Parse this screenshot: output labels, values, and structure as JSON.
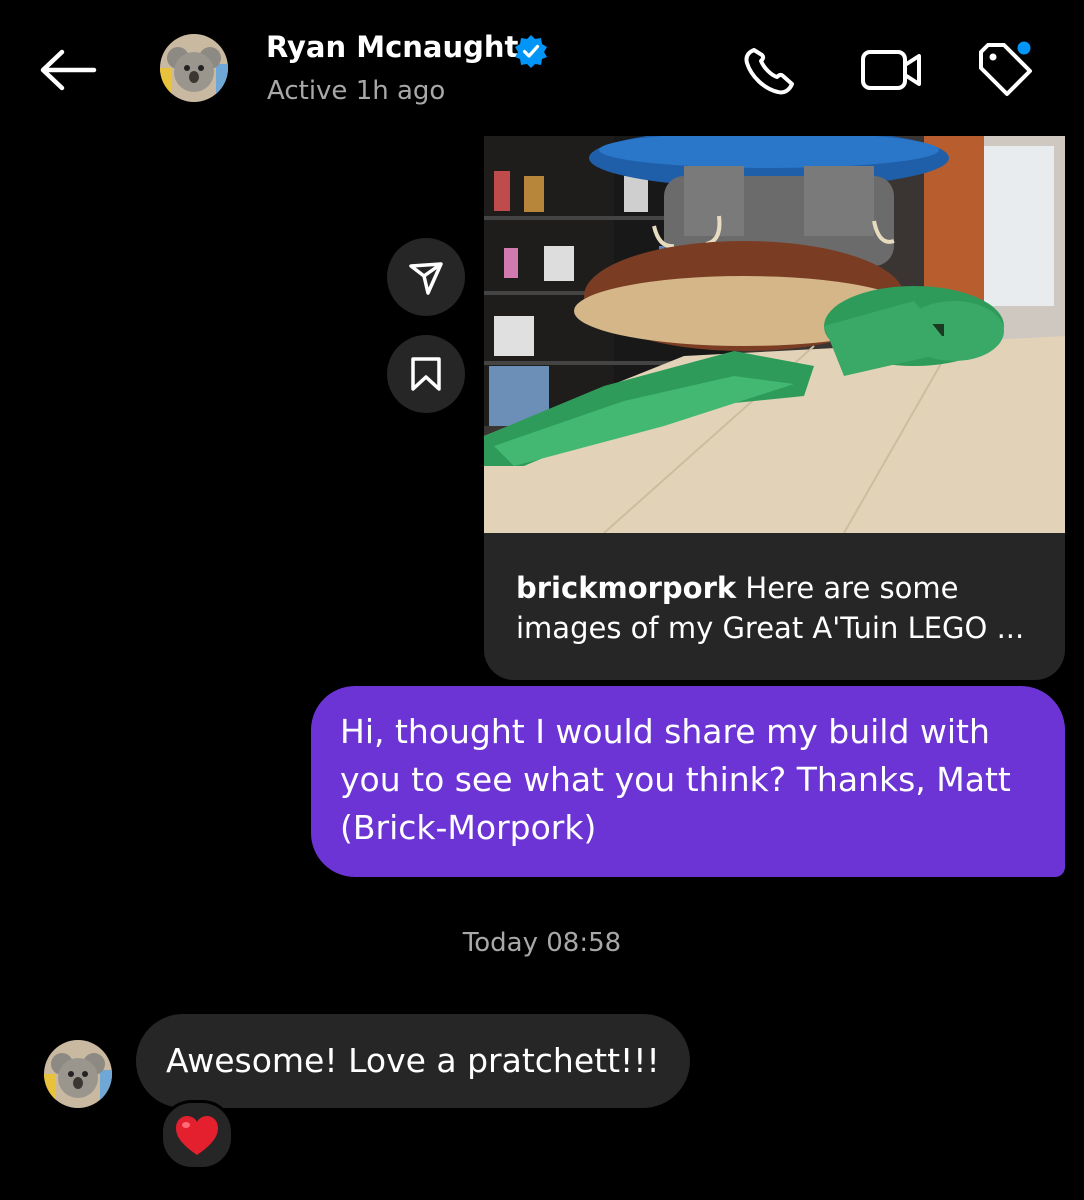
{
  "header": {
    "contact_name": "Ryan Mcnaught",
    "status": "Active 1h ago",
    "verified": true
  },
  "shared_post": {
    "username": "brickmorpork",
    "caption": "Here are some images of my Great A'Tuin LEGO ..."
  },
  "messages": {
    "sent_text": "Hi, thought I would share my build with you to see what you think? Thanks, Matt (Brick-Morpork)",
    "timestamp": "Today 08:58",
    "received_text": "Awesome! Love a pratchett!!!",
    "reaction": "❤️"
  },
  "colors": {
    "sent_bubble": "#6c34d4",
    "received_bubble": "#262626",
    "verified_badge": "#0095f6",
    "notification_dot": "#0095f6"
  },
  "icons": [
    "back-arrow-icon",
    "phone-icon",
    "video-camera-icon",
    "tag-icon",
    "share-icon",
    "bookmark-icon",
    "verified-icon",
    "heart-icon"
  ]
}
